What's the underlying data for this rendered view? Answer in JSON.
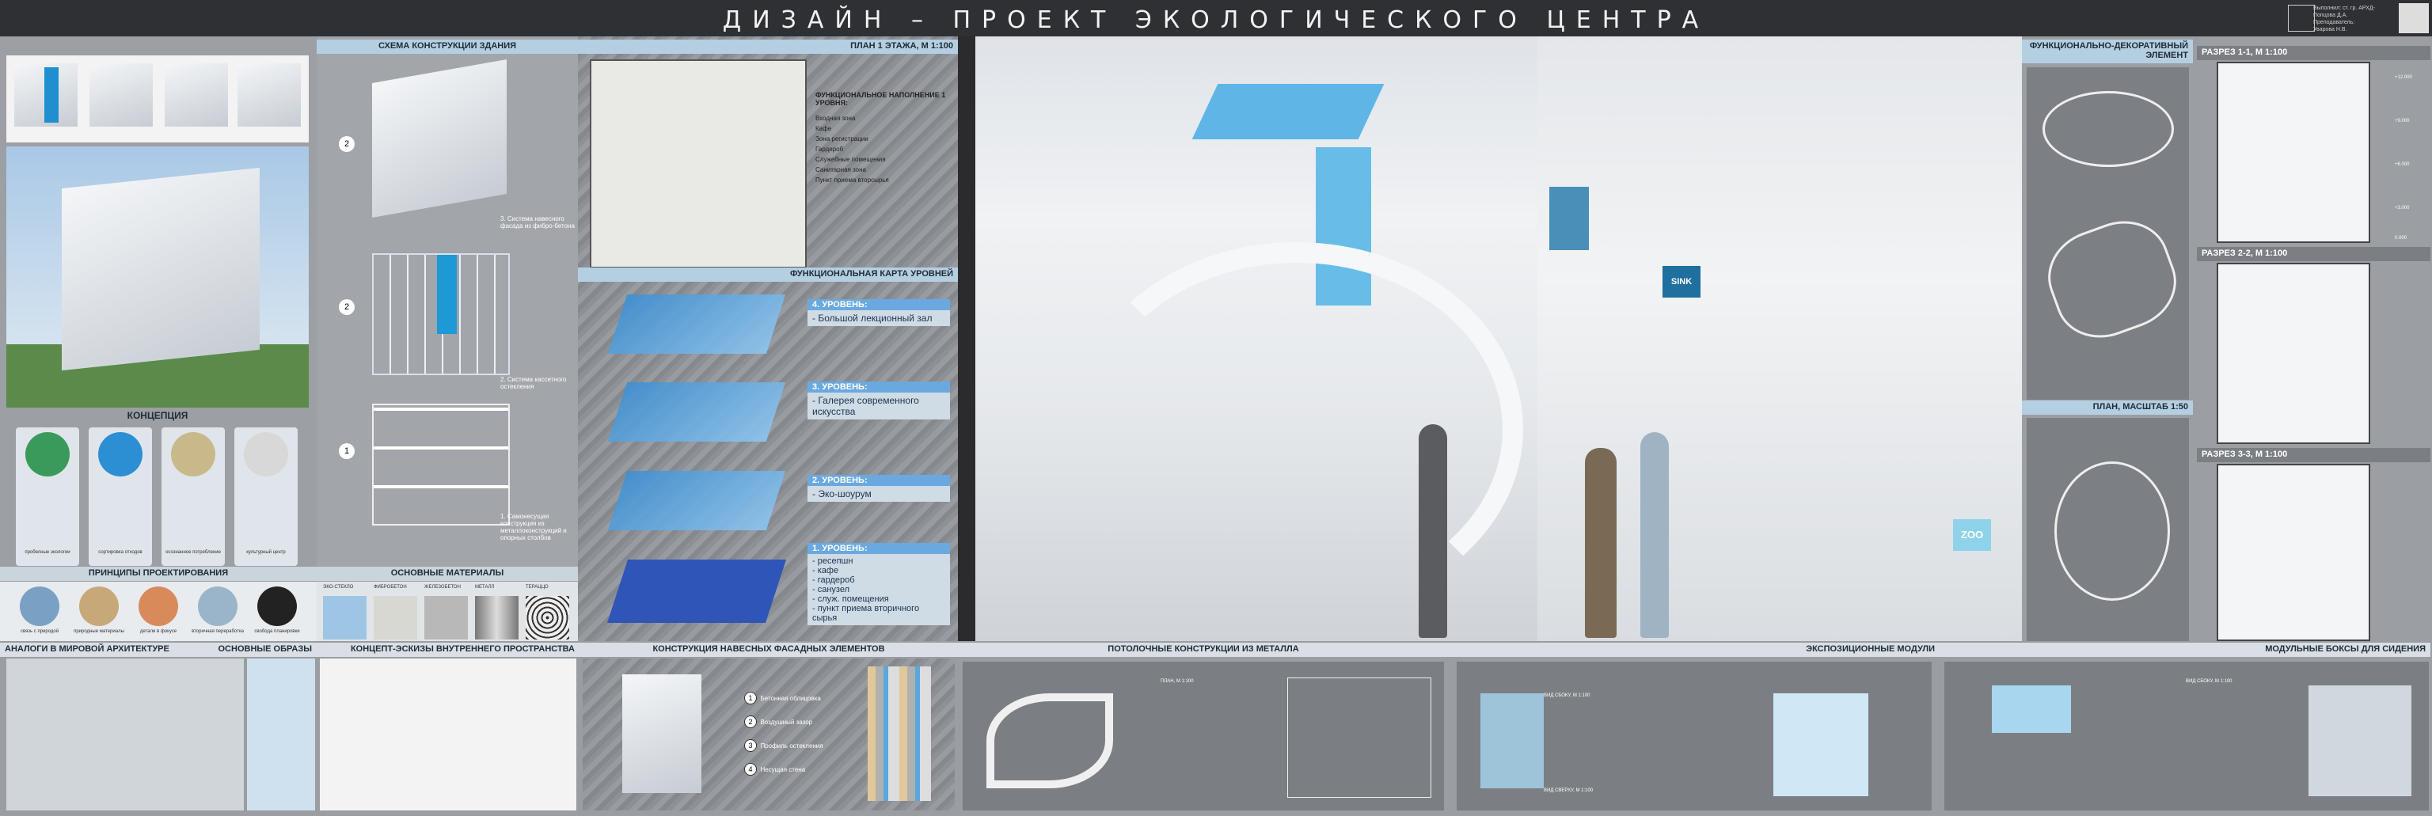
{
  "title": "ДИЗАЙН – ПРОЕКТ ЭКОЛОГИЧЕСКОГО ЦЕНТРА",
  "author_lines": [
    "Выполнил: ст. гр. АРХД-",
    "Попцова Д.А.",
    "Преподаватель:",
    "Уварова Н.В."
  ],
  "colors": {
    "accent": "#b5cfe2",
    "level_blue": "#3e8fd1",
    "panel": "#9c9fa3",
    "topbar": "#2f3034"
  },
  "sections": {
    "construction_scheme": "СХЕМА КОНСТРУКЦИИ ЗДАНИЯ",
    "floor_plan": "ПЛАН 1 ЭТАЖА, М 1:100",
    "functional_map": "ФУНКЦИОНАЛЬНАЯ КАРТА УРОВНЕЙ",
    "concept": "КОНЦЕПЦИЯ",
    "principles": "ПРИНЦИПЫ ПРОЕКТИРОВАНИЯ",
    "materials": "ОСНОВНЫЕ МАТЕРИАЛЫ",
    "analogs": "АНАЛОГИ В МИРОВОЙ АРХИТЕКТУРЕ",
    "images": "ОСНОВНЫЕ ОБРАЗЫ",
    "sketches": "КОНЦЕПТ-ЭСКИЗЫ ВНУТРЕННЕГО ПРОСТРАНСТВА",
    "facade": "КОНСТРУКЦИЯ НАВЕСНЫХ ФАСАДНЫХ ЭЛЕМЕНТОВ",
    "ceiling": "ПОТОЛОЧНЫЕ КОНСТРУКЦИИ ИЗ МЕТАЛЛА",
    "modules": "ЭКСПОЗИЦИОННЫЕ МОДУЛИ",
    "boxes": "МОДУЛЬНЫЕ БОКСЫ ДЛЯ СИДЕНИЯ",
    "decor": "ФУНКЦИОНАЛЬНО-ДЕКОРАТИВНЫЙ ЭЛЕМЕНТ",
    "plan150": "ПЛАН, МАСШТАБ 1:50",
    "section1": "РАЗРЕЗ 1-1, М 1:100",
    "section2": "РАЗРЕЗ 2-2, М 1:100",
    "section3": "РАЗРЕЗ 3-3, М 1:100"
  },
  "construction_labels": [
    "3. Система навесного фасада из фибро-бетона",
    "2. Система кассетного остекления",
    "1. Самонесущая конструкция из металлоконструкций и опорных столбов"
  ],
  "construction_numbers": [
    "2",
    "2",
    "1"
  ],
  "plan_legend_title": "ФУНКЦИОНАЛЬНОЕ НАПОЛНЕНИЕ 1 УРОВНЯ:",
  "plan_legend": [
    "Входная зона",
    "Кафе",
    "Зона регистрации",
    "Гардероб",
    "Служебные помещения",
    "Санитарная зона",
    "Пункт приема вторсырья"
  ],
  "levels": [
    {
      "title": "4. УРОВЕНЬ:",
      "desc": "- Большой лекционный зал"
    },
    {
      "title": "3. УРОВЕНЬ:",
      "desc": "- Галерея современного искусства"
    },
    {
      "title": "2. УРОВЕНЬ:",
      "desc": "- Эко-шоурум"
    },
    {
      "title": "1. УРОВЕНЬ:",
      "desc": "- ресепшн\n- кафе\n- гардероб\n- санузел\n- служ. помещения\n- пункт приема вторичного сырья"
    }
  ],
  "concept_items": [
    "пробелные экологии",
    "сортировка отходов",
    "осознанное потребление",
    "культурный центр"
  ],
  "principles_items": [
    "связь с природой",
    "природные материалы",
    "детали в фокусе",
    "вторичная переработка",
    "свобода планировки"
  ],
  "materials_items": [
    "ЭКО-СТЕКЛО",
    "ФИБРОБЕТОН",
    "ЖЕЛЕЗОБЕТОН",
    "МЕТАЛЛ",
    "ТЕРАЦЦО"
  ],
  "facade_labels": [
    "Бетонная облицовка",
    "Воздушный зазор",
    "Профиль остекления",
    "Несущая стена"
  ],
  "facade_numbers": [
    "1",
    "2",
    "3",
    "4"
  ],
  "ceiling_plan_label": "ПЛАН, М 1:100",
  "modules_labels": [
    "ВИД СБОКУ, М 1:100",
    "ВИД СВЕРХУ, М 1:100"
  ],
  "boxes_label": "ВИД СБОКУ, М 1:100",
  "section_marks": [
    "0.000",
    "+3.000",
    "+6.000",
    "+9.000",
    "+12.000"
  ],
  "signs": [
    "SINK",
    "ZOO"
  ]
}
